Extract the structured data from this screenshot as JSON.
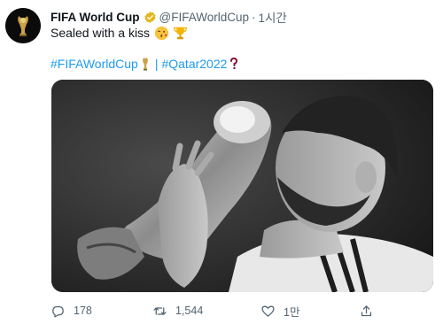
{
  "tweet": {
    "author_name": "FIFA World Cup",
    "author_handle": "@FIFAWorldCup",
    "separator": "·",
    "time": "1시간",
    "text": "Sealed with a kiss",
    "text_emojis": [
      "kiss-emoji",
      "trophy-emoji"
    ],
    "hashtag_1": "#FIFAWorldCup",
    "hashtag_separator": "|",
    "hashtag_2": "#Qatar2022",
    "media_description": "black-and-white photo"
  },
  "actions": {
    "reply_count": "178",
    "retweet_count": "1,544",
    "like_count": "1만"
  },
  "colors": {
    "link": "#1d9bf0",
    "secondary": "#536471",
    "verified": "#e2b719"
  }
}
